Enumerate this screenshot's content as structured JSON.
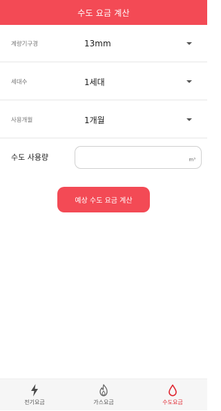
{
  "header": {
    "title": "수도 요금 계산"
  },
  "form": {
    "rows": [
      {
        "label": "계량기구경",
        "value": "13mm"
      },
      {
        "label": "세대수",
        "value": "1세대"
      },
      {
        "label": "사용개월",
        "value": "1개월"
      }
    ],
    "usage": {
      "label": "수도 사용량",
      "value": "",
      "unit": "m³"
    }
  },
  "actions": {
    "calculate_label": "예상 수도 요금 계산"
  },
  "bottom_nav": {
    "items": [
      {
        "label": "전기요금",
        "icon": "lightning-icon"
      },
      {
        "label": "가스요금",
        "icon": "flame-icon"
      },
      {
        "label": "수도요금",
        "icon": "water-drop-icon",
        "active": true
      }
    ],
    "active_color": "#e0252f"
  },
  "colors": {
    "accent": "#f34a55"
  }
}
